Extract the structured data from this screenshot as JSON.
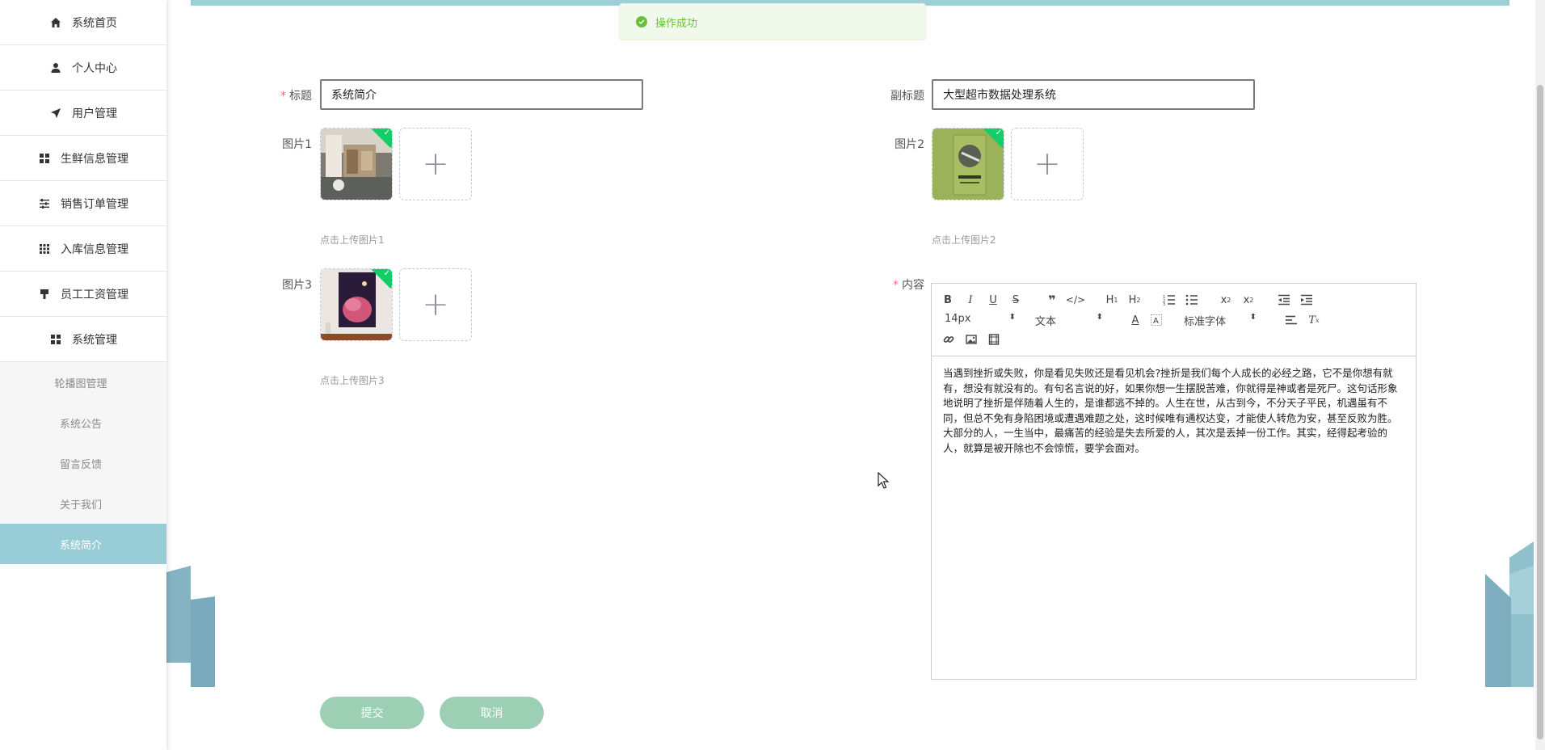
{
  "sidebar": {
    "items": [
      {
        "label": "系统首页",
        "icon": "home-icon"
      },
      {
        "label": "个人中心",
        "icon": "user-icon"
      },
      {
        "label": "用户管理",
        "icon": "send-icon"
      },
      {
        "label": "生鲜信息管理",
        "icon": "grid-icon"
      },
      {
        "label": "销售订单管理",
        "icon": "sliders-icon"
      },
      {
        "label": "入库信息管理",
        "icon": "apps-icon"
      },
      {
        "label": "员工工资管理",
        "icon": "brush-icon"
      },
      {
        "label": "系统管理",
        "icon": "grid-icon"
      }
    ],
    "subitems": [
      {
        "label": "轮播图管理"
      },
      {
        "label": "系统公告"
      },
      {
        "label": "留言反馈"
      },
      {
        "label": "关于我们"
      },
      {
        "label": "系统简介",
        "active": true
      }
    ]
  },
  "toast": {
    "message": "操作成功"
  },
  "form": {
    "title_label": "标题",
    "title_value": "系统简介",
    "subtitle_label": "副标题",
    "subtitle_value": "大型超市数据处理系统",
    "image1_label": "图片1",
    "image1_hint": "点击上传图片1",
    "image2_label": "图片2",
    "image2_hint": "点击上传图片2",
    "image3_label": "图片3",
    "image3_hint": "点击上传图片3",
    "content_label": "内容",
    "content_text": "当遇到挫折或失败，你是看见失败还是看见机会?挫折是我们每个人成长的必经之路，它不是你想有就有，想没有就没有的。有句名言说的好，如果你想一生摆脱苦难，你就得是神或者是死尸。这句话形象地说明了挫折是伴随着人生的，是谁都逃不掉的。人生在世，从古到今，不分天子平民，机遇虽有不同，但总不免有身陷困境或遭遇难题之处，这时候唯有通权达变，才能使人转危为安，甚至反败为胜。大部分的人，一生当中，最痛苦的经验是失去所爱的人，其次是丢掉一份工作。其实，经得起考验的人，就算是被开除也不会惊慌，要学会面对。",
    "submit_label": "提交",
    "cancel_label": "取消"
  },
  "editor": {
    "font_size": "14px",
    "header_select": "文本",
    "font_family": "标准字体"
  },
  "colors": {
    "accent": "#98ccd6",
    "button": "#9dcfb4",
    "success": "#67c23a"
  }
}
